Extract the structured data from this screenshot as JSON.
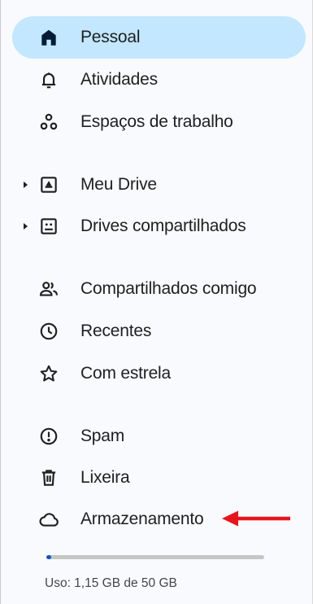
{
  "nav": {
    "personal": {
      "label": "Pessoal",
      "icon": "home-icon"
    },
    "activity": {
      "label": "Atividades",
      "icon": "bell-icon"
    },
    "workspaces": {
      "label": "Espaços de trabalho",
      "icon": "workspaces-icon"
    },
    "my_drive": {
      "label": "Meu Drive",
      "icon": "drive-icon"
    },
    "shared_drives": {
      "label": "Drives compartilhados",
      "icon": "shared-drives-icon"
    },
    "shared_with_me": {
      "label": "Compartilhados comigo",
      "icon": "people-icon"
    },
    "recent": {
      "label": "Recentes",
      "icon": "clock-icon"
    },
    "starred": {
      "label": "Com estrela",
      "icon": "star-icon"
    },
    "spam": {
      "label": "Spam",
      "icon": "spam-icon"
    },
    "trash": {
      "label": "Lixeira",
      "icon": "trash-icon"
    },
    "storage": {
      "label": "Armazenamento",
      "icon": "cloud-icon"
    }
  },
  "storage": {
    "usage_text": "Uso: 1,15 GB de 50 GB",
    "used_fraction": 0.023
  },
  "colors": {
    "active_bg": "#c2e7ff",
    "progress": "#0b57d0",
    "annotation_arrow": "#e8141c"
  }
}
